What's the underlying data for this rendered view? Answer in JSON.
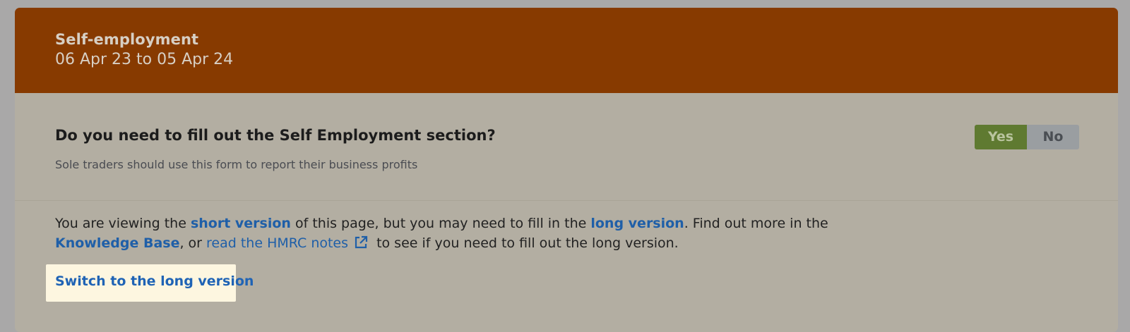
{
  "header": {
    "title": "Self-employment",
    "period": "06 Apr 23 to 05 Apr 24"
  },
  "question": {
    "text": "Do you need to fill out the Self Employment section?",
    "hint": "Sole traders should use this form to report their business profits",
    "options": {
      "yes": "Yes",
      "no": "No"
    },
    "selected": "Yes"
  },
  "info": {
    "part1": "You are viewing the ",
    "short_link": "short version",
    "part2": " of this page, but you may need to fill in the ",
    "long_link": "long version",
    "part3": ". Find out more in the ",
    "kb_link": "Knowledge Base",
    "part4": ", or ",
    "hmrc_link": "read the HMRC notes",
    "part5": " to see if you need to fill out the long version."
  },
  "switch": {
    "label": "Switch to the long version"
  },
  "colors": {
    "header_bg": "#873a00",
    "card_bg": "#b3aea2",
    "yes_bg": "#5f7a31",
    "no_bg": "#9a9ea1",
    "link": "#1f5fa8",
    "switch_bg": "#fdf6e0"
  },
  "icons": {
    "external_link": "external-link-icon"
  }
}
